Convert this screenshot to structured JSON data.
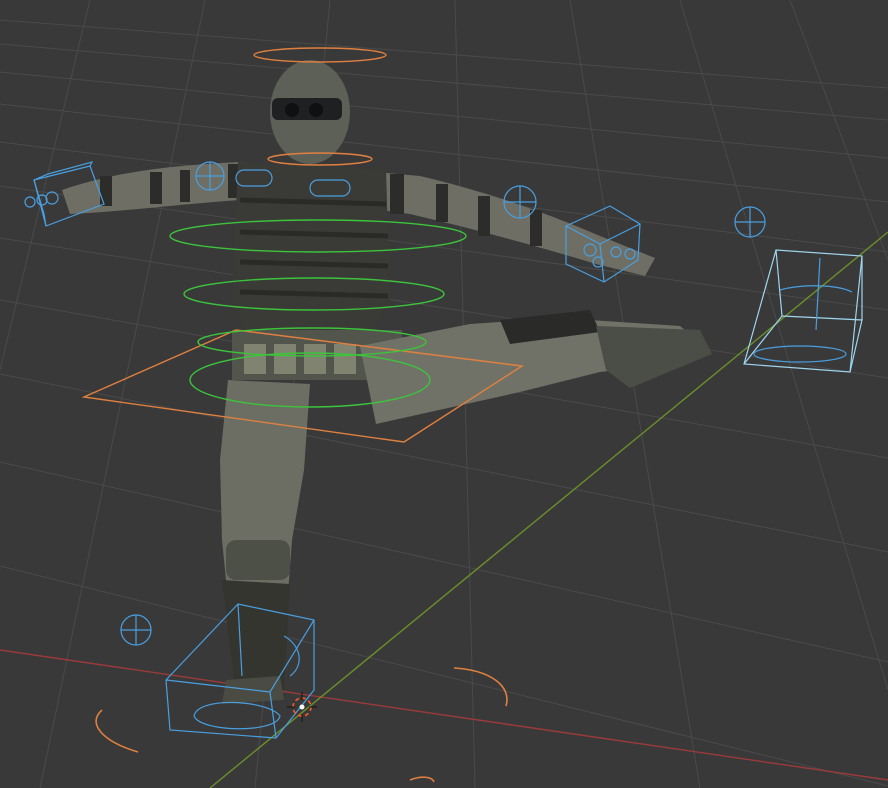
{
  "app": {
    "name": "",
    "view": "3d-viewport"
  },
  "colors": {
    "background": "#393939",
    "grid_line": "#4a4a4a",
    "x_axis": "#9b3a3a",
    "y_axis": "#6b8f2a",
    "ik_control": "#4a9fe0",
    "fk_ring": "#e08040",
    "torso_ring": "#3cc43c",
    "cursor": "#ff5a2a"
  },
  "icons": {
    "cursor": "3d-cursor-icon",
    "pole": "pole-target-icon"
  },
  "scene": {
    "object": "soldier-character-mesh",
    "armature_controls": [
      "head-control",
      "neck-control",
      "chest-control",
      "spine-control",
      "hips-control",
      "root-control",
      "left-hand-ik-control",
      "right-hand-ik-control",
      "left-leg-ik-control",
      "right-foot-ik-control",
      "left-foot-roll-arc",
      "right-foot-roll-arc"
    ]
  }
}
